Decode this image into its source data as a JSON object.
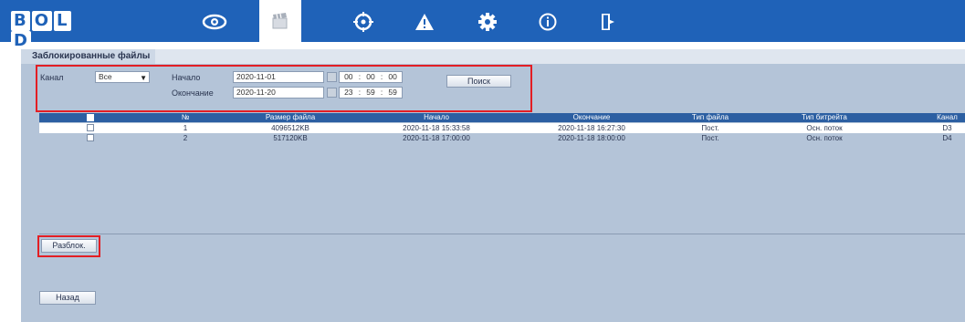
{
  "header": {
    "logo_text": "BOLID",
    "nav_items": [
      {
        "name": "live-view",
        "icon": "eye-icon"
      },
      {
        "name": "playback",
        "icon": "clapperboard-icon",
        "active": true
      },
      {
        "name": "ptz",
        "icon": "target-icon"
      },
      {
        "name": "events",
        "icon": "warning-icon"
      },
      {
        "name": "settings",
        "icon": "gear-icon"
      },
      {
        "name": "info",
        "icon": "info-icon"
      },
      {
        "name": "logout",
        "icon": "exit-icon"
      }
    ],
    "bar_color": "#1f62b8"
  },
  "page": {
    "title": "Заблокированные файлы"
  },
  "filter": {
    "channel_label": "Канал",
    "channel_value": "Все",
    "start_label": "Начало",
    "start_date": "2020-11-01",
    "start_time": [
      "00",
      "00",
      "00"
    ],
    "end_label": "Окончание",
    "end_date": "2020-11-20",
    "end_time": [
      "23",
      "59",
      "59"
    ],
    "search_button": "Поиск"
  },
  "table": {
    "columns": [
      "№",
      "Размер файла",
      "Начало",
      "Окончание",
      "Тип файла",
      "Тип битрейта",
      "Канал"
    ],
    "rows": [
      {
        "no": "1",
        "size": "4096512KB",
        "start": "2020-11-18 15:33:58",
        "end": "2020-11-18 16:27:30",
        "file_type": "Пост.",
        "bitrate_type": "Осн. поток",
        "channel": "D3"
      },
      {
        "no": "2",
        "size": "517120KB",
        "start": "2020-11-18 17:00:00",
        "end": "2020-11-18 18:00:00",
        "file_type": "Пост.",
        "bitrate_type": "Осн. поток",
        "channel": "D4"
      }
    ]
  },
  "actions": {
    "unlock_button": "Разблок.",
    "back_button": "Назад"
  },
  "colors": {
    "highlight": "#e31e24",
    "table_header": "#2c5fa2",
    "panel": "#b4c4d8"
  }
}
